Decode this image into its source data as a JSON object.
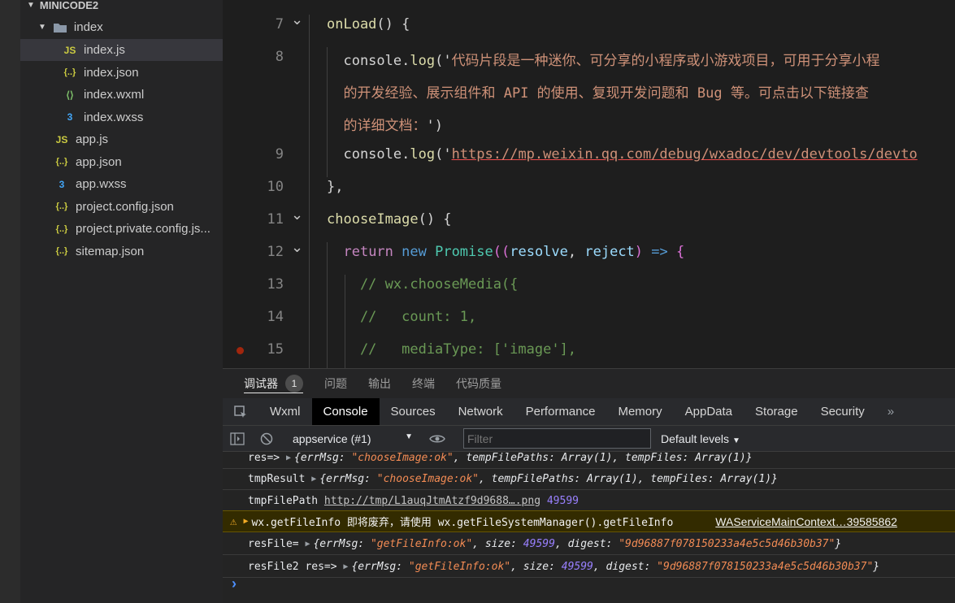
{
  "explorer": {
    "project": "MINICODE2",
    "folder": "index",
    "items": [
      {
        "label": "index.js",
        "icon": "js-file-icon",
        "glyph": "JS",
        "depth": 2,
        "active": true
      },
      {
        "label": "index.json",
        "icon": "json-file-icon",
        "glyph": "{..}",
        "depth": 2
      },
      {
        "label": "index.wxml",
        "icon": "wxml-file-icon",
        "glyph": "⟨⟩",
        "depth": 2
      },
      {
        "label": "index.wxss",
        "icon": "wxss-file-icon",
        "glyph": "3",
        "depth": 2
      },
      {
        "label": "app.js",
        "icon": "js-file-icon",
        "glyph": "JS",
        "depth": 1
      },
      {
        "label": "app.json",
        "icon": "json-file-icon",
        "glyph": "{..}",
        "depth": 1
      },
      {
        "label": "app.wxss",
        "icon": "wxss-file-icon",
        "glyph": "3",
        "depth": 1
      },
      {
        "label": "project.config.json",
        "icon": "json-file-icon",
        "glyph": "{..}",
        "depth": 1
      },
      {
        "label": "project.private.config.js...",
        "icon": "json-file-icon",
        "glyph": "{..}",
        "depth": 1
      },
      {
        "label": "sitemap.json",
        "icon": "json-file-icon",
        "glyph": "{..}",
        "depth": 1
      }
    ]
  },
  "editor": {
    "lines": [
      {
        "num": "7",
        "fold": true,
        "tokens": [
          [
            "onLoad",
            "#dcdcaa"
          ],
          [
            "() {",
            "#d4d4d4"
          ]
        ]
      },
      {
        "num": "8",
        "tokens": [
          [
            "  console.",
            "#d4d4d4"
          ],
          [
            "log",
            "#dcdcaa"
          ],
          [
            "('",
            "#d4d4d4"
          ],
          [
            "代码片段是一种迷你、可分享的小程序或小游戏项目，可用于分享小程",
            "#ce9178"
          ]
        ]
      },
      {
        "num": "",
        "tokens": [
          [
            "  的开发经验、展示组件和 API 的使用、复现开发问题和 Bug 等。可点击以下链接查",
            "#ce9178"
          ]
        ]
      },
      {
        "num": "",
        "tokens": [
          [
            "  的详细文档：",
            "#ce9178"
          ],
          [
            "')",
            "#d4d4d4"
          ]
        ]
      },
      {
        "num": "9",
        "tokens": [
          [
            "  console.",
            "#d4d4d4"
          ],
          [
            "log",
            "#dcdcaa"
          ],
          [
            "('",
            "#d4d4d4"
          ],
          [
            "https://mp.weixin.qq.com/debug/wxadoc/dev/devtools/devto",
            "#ce9178"
          ]
        ],
        "url": true
      },
      {
        "num": "10",
        "tokens": [
          [
            "},",
            "#d4d4d4"
          ]
        ]
      },
      {
        "num": "11",
        "fold": true,
        "tokens": [
          [
            "chooseImage",
            "#dcdcaa"
          ],
          [
            "() {",
            "#d4d4d4"
          ]
        ]
      },
      {
        "num": "12",
        "fold": true,
        "tokens": [
          [
            "  ",
            "#d4d4d4"
          ],
          [
            "return",
            "#c586c0"
          ],
          [
            " new ",
            "#569cd6"
          ],
          [
            "Promise",
            "#4ec9b0"
          ],
          [
            "((",
            "#da70d6"
          ],
          [
            "resolve",
            "#9cdcfe"
          ],
          [
            ", ",
            "#d4d4d4"
          ],
          [
            "reject",
            "#9cdcfe"
          ],
          [
            ") ",
            "#da70d6"
          ],
          [
            "=>",
            "#569cd6"
          ],
          [
            " {",
            "#da70d6"
          ]
        ]
      },
      {
        "num": "13",
        "tokens": [
          [
            "    // wx.chooseMedia({",
            "#6a9955"
          ]
        ]
      },
      {
        "num": "14",
        "tokens": [
          [
            "    //   count: 1,",
            "#6a9955"
          ]
        ]
      },
      {
        "num": "15",
        "breakpoint": true,
        "tokens": [
          [
            "    //   mediaType: ['image'],",
            "#6a9955"
          ]
        ]
      }
    ]
  },
  "panel_tabs": [
    {
      "label": "调试器",
      "badge": "1",
      "active": true
    },
    {
      "label": "问题"
    },
    {
      "label": "输出"
    },
    {
      "label": "终端"
    },
    {
      "label": "代码质量"
    }
  ],
  "devtools_tabs": [
    "Wxml",
    "Console",
    "Sources",
    "Network",
    "Performance",
    "Memory",
    "AppData",
    "Storage",
    "Security"
  ],
  "devtools_active": "Console",
  "toolbar": {
    "context": "appservice (#1)",
    "filter_placeholder": "Filter",
    "levels": "Default levels"
  },
  "console": {
    "lines": [
      {
        "prefix": "res=> ",
        "obj": [
          [
            "{errMsg: ",
            ""
          ],
          [
            "\"chooseImage:ok\"",
            "str"
          ],
          [
            ", tempFilePaths: Array(1), tempFiles: Array(1)}",
            ""
          ]
        ]
      },
      {
        "prefix": "tmpResult ",
        "obj": [
          [
            "{errMsg: ",
            ""
          ],
          [
            "\"chooseImage:ok\"",
            "str"
          ],
          [
            ", tempFilePaths: Array(1), tempFiles: Array(1)}",
            ""
          ]
        ]
      },
      {
        "prefix": "tmpFilePath ",
        "link": "http://tmp/L1auqJtmAtzf9d9688….png",
        "after": " 49599"
      },
      {
        "warning": true,
        "text": "wx.getFileInfo 即将废弃，请使用 wx.getFileSystemManager().getFileInfo",
        "source": "WAServiceMainContext…39585862"
      },
      {
        "prefix": "resFile= ",
        "obj": [
          [
            "{errMsg: ",
            ""
          ],
          [
            "\"getFileInfo:ok\"",
            "str"
          ],
          [
            ", size: ",
            ""
          ],
          [
            "49599",
            "num"
          ],
          [
            ", digest: ",
            ""
          ],
          [
            "\"9d96887f078150233a4e5c5d46b30b37\"",
            "str"
          ],
          [
            "}",
            ""
          ]
        ]
      },
      {
        "prefix": "resFile2 res=> ",
        "obj": [
          [
            "{errMsg: ",
            ""
          ],
          [
            "\"getFileInfo:ok\"",
            "str"
          ],
          [
            ", size: ",
            ""
          ],
          [
            "49599",
            "num"
          ],
          [
            ", digest: ",
            ""
          ],
          [
            "\"9d96887f078150233a4e5c5d46b30b37\"",
            "str"
          ],
          [
            "}",
            ""
          ]
        ]
      }
    ]
  }
}
